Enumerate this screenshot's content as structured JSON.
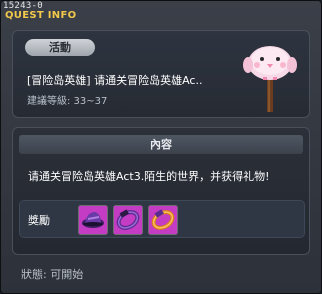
{
  "window": {
    "quest_id": "15243-0",
    "title": "QUEST INFO"
  },
  "summary": {
    "badge": "活動",
    "quest_name": "[冒险岛英雄] 请通关冒险岛英雄Ac..",
    "level_requirement": "建議等級: 33~37",
    "npc_icon": "pink-bird-on-signpost-icon"
  },
  "content": {
    "header": "內容",
    "description": "请通关冒险岛英雄Act3.陌生的世界，并获得礼物!",
    "reward_label": "獎勵",
    "rewards": [
      {
        "icon": "purple-hat-icon"
      },
      {
        "icon": "purple-ring-icon"
      },
      {
        "icon": "orange-ring-icon"
      }
    ]
  },
  "status": {
    "text": "狀態: 可開始"
  },
  "colors": {
    "title": "#f2c94c",
    "panel_bg": "#2e3440",
    "item_border": "#6e6e6e"
  }
}
